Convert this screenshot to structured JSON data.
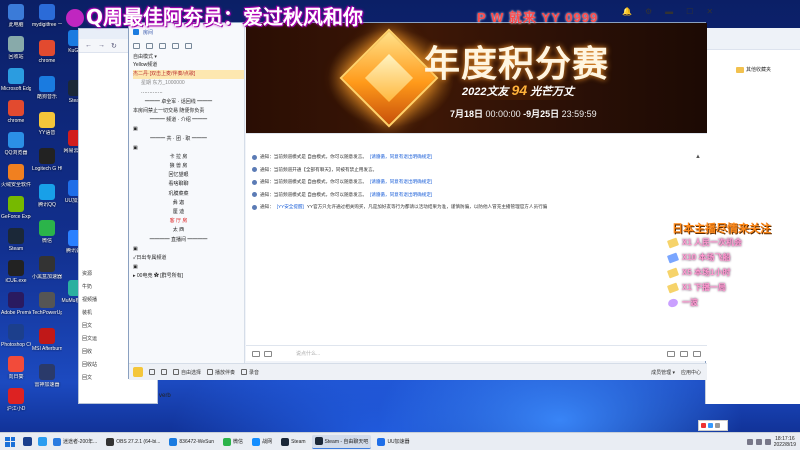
{
  "stream_title": "Q周最佳阿夯员：爱过秋风和你",
  "stream_pw": "P W 就来 YY 0999",
  "side_note": "日本主播尽情来关注",
  "gifts": [
    {
      "text": "X1 人民一次机会"
    },
    {
      "text": "X10 本场飞船"
    },
    {
      "text": "X5 本场1小时"
    },
    {
      "text": "X1 下播一局"
    },
    {
      "text": "一波"
    }
  ],
  "desktop_icons_left": [
    {
      "label": "此电脑",
      "color": "#3b7bd8"
    },
    {
      "label": "回收站",
      "color": "#8aa"
    },
    {
      "label": "Microsoft Edge",
      "color": "#2b9ce0"
    },
    {
      "label": "chrome",
      "color": "#e24a2f"
    },
    {
      "label": "QQ浏览器",
      "color": "#2b8fe6"
    },
    {
      "label": "火绒安全软件",
      "color": "#f08020"
    },
    {
      "label": "GeForce Experience",
      "color": "#76b900"
    },
    {
      "label": "Steam",
      "color": "#1b2838"
    },
    {
      "label": "iCUE.exe",
      "color": "#222"
    },
    {
      "label": "Adobe Premiere",
      "color": "#2a1a60"
    },
    {
      "label": "Photoshop CC 2019",
      "color": "#1c3f8c"
    },
    {
      "label": "向日葵",
      "color": "#f24b3a"
    },
    {
      "label": "沪江小D",
      "color": "#d22"
    }
  ],
  "desktop_icons_col2": [
    {
      "label": "mydigitfree 一键重装",
      "color": "#2b6bd8"
    },
    {
      "label": "chrome",
      "color": "#e24a2f"
    },
    {
      "label": "酷狗音乐",
      "color": "#1a7be0"
    },
    {
      "label": "YY语音",
      "color": "#f4c63a"
    },
    {
      "label": "Logitech G HUB",
      "color": "#222"
    },
    {
      "label": "腾讯QQ",
      "color": "#18a0e8"
    },
    {
      "label": "微信",
      "color": "#2bb44a"
    },
    {
      "label": "小黑盒加速器",
      "color": "#333"
    },
    {
      "label": "TechPowerUp GPU-Z",
      "color": "#555"
    },
    {
      "label": "MSI Afterburner",
      "color": "#c01818"
    },
    {
      "label": "雷神加速器",
      "color": "#2a3a6a"
    }
  ],
  "desktop_icons_col3": [
    {
      "label": "KuGou",
      "color": "#1a7be0"
    },
    {
      "label": "Steam",
      "color": "#1b2838"
    },
    {
      "label": "网易云音乐",
      "color": "#d21d1d"
    },
    {
      "label": "UU加速器",
      "color": "#1e6ee8"
    },
    {
      "label": "腾讯会议",
      "color": "#2a80ff"
    },
    {
      "label": "MuMu模拟器",
      "color": "#2bb0a0"
    }
  ],
  "filewin": {
    "nav": [
      "←",
      "→",
      "↻"
    ],
    "side_items": [
      "资源",
      "牛奶",
      "视频播",
      "装机",
      "回文",
      "回文运",
      "回收",
      "回收站",
      "回文"
    ],
    "footer": "verb"
  },
  "rightwin": {
    "folder_label": "其他收藏夹"
  },
  "yy_left": {
    "top_label": "房间",
    "mode_label": "自由模式 ▾",
    "tree": [
      {
        "text": "Yellow频道",
        "cls": ""
      },
      {
        "text": "杰二丹·[双击上麦/伴奏/点歌]",
        "cls": "hl"
      },
      {
        "text": "星期   东方_1000000",
        "cls": "indent1 sub"
      },
      {
        "text": "·············",
        "cls": "indent1"
      },
      {
        "text": "━━━ 卓全军 · 话回线 ━━━",
        "cls": "center"
      },
      {
        "text": "本房间禁止一切交易 随便你负责",
        "cls": ""
      },
      {
        "text": "━━━ 频道 · 介绍 ━━━",
        "cls": "center"
      },
      {
        "text": "▣",
        "cls": ""
      },
      {
        "text": "━━━ 共 · 团 · 职 ━━━",
        "cls": "center"
      },
      {
        "text": "▣",
        "cls": ""
      },
      {
        "text": "卡  拉  房",
        "cls": "center"
      },
      {
        "text": "狼  兽  房",
        "cls": "center"
      },
      {
        "text": "回忆望眼",
        "cls": "center"
      },
      {
        "text": "看啥聊聊",
        "cls": "center"
      },
      {
        "text": "巩膜菜菜",
        "cls": "center"
      },
      {
        "text": "彝  迦",
        "cls": "center"
      },
      {
        "text": "厘  迪",
        "cls": "center"
      },
      {
        "text": "客 厅 房",
        "cls": "center red"
      },
      {
        "text": "太  西",
        "cls": "center"
      },
      {
        "text": "━━━━ 直播间 ━━━━",
        "cls": "center"
      },
      {
        "text": "▣",
        "cls": ""
      },
      {
        "text": "✓日出专属频道",
        "cls": ""
      },
      {
        "text": "▣",
        "cls": ""
      },
      {
        "text": "▸ 00电竞 ✿ [群号所有]",
        "cls": ""
      }
    ]
  },
  "banner": {
    "title": "年度积分赛",
    "subtitle_pre": "2022文友",
    "subtitle_num": "94",
    "subtitle_post": "光芒万丈",
    "date": "7月18日",
    "date_t1": "00:00:00",
    "date_mid": "-9月25日",
    "date_t2": "23:59:59"
  },
  "chat": {
    "messages": [
      {
        "pre": "通知：当前频道模式是 自由模式，你可以随意发言。",
        "hl": "[请遵循，同意有退出明确规定]",
        "post": ""
      },
      {
        "pre": "通知：当前频道开通【全部有聊天】，同被有禁止用发言。",
        "hl": "",
        "post": ""
      },
      {
        "pre": "通知：当前频道模式是 自由模式，你可以随意发言。",
        "hl": "[请遵循，同意有退出明确规定]",
        "post": ""
      },
      {
        "pre": "通知：当前频道模式是 自由模式，你可以随意发言。",
        "hl": "[请遵循，同意有退出明确规定]",
        "post": ""
      },
      {
        "pre": "通知：",
        "hl": "[YY安全提醒]",
        "post": " YY官方只允许通过相关购买，凡是加好友等行为都请以活动结果为准，谨慎防骗，以防他人冒充主播管理官方人员行骗"
      }
    ],
    "input_placeholder": "说点什么..."
  },
  "yy_bottom": {
    "items": [
      "自由选择",
      "播放伴奏",
      "录音"
    ],
    "right_items": [
      "成员管理 ▾",
      "应用中心"
    ]
  },
  "taskbar": {
    "buttons": [
      {
        "label": "迷途者-200年...",
        "color": "#2a7be0",
        "active": false
      },
      {
        "label": "OBS 27.2.1 (64-bi...",
        "color": "#333",
        "active": false
      },
      {
        "label": "836472-WeSun",
        "color": "#1a7be0",
        "active": false
      },
      {
        "label": "微信",
        "color": "#2bb44a",
        "active": false
      },
      {
        "label": "战网",
        "color": "#148eff",
        "active": false
      },
      {
        "label": "Steam",
        "color": "#1b2838",
        "active": false
      },
      {
        "label": "Steam - 自由聊天吧",
        "color": "#1b2838",
        "active": true
      },
      {
        "label": "UU加速器",
        "color": "#1e6ee8",
        "active": false
      }
    ],
    "time": "18:17:16",
    "date": "2022/8/19"
  },
  "window_controls": [
    "🔔",
    "⚙",
    "▬",
    "☐",
    "✕"
  ]
}
